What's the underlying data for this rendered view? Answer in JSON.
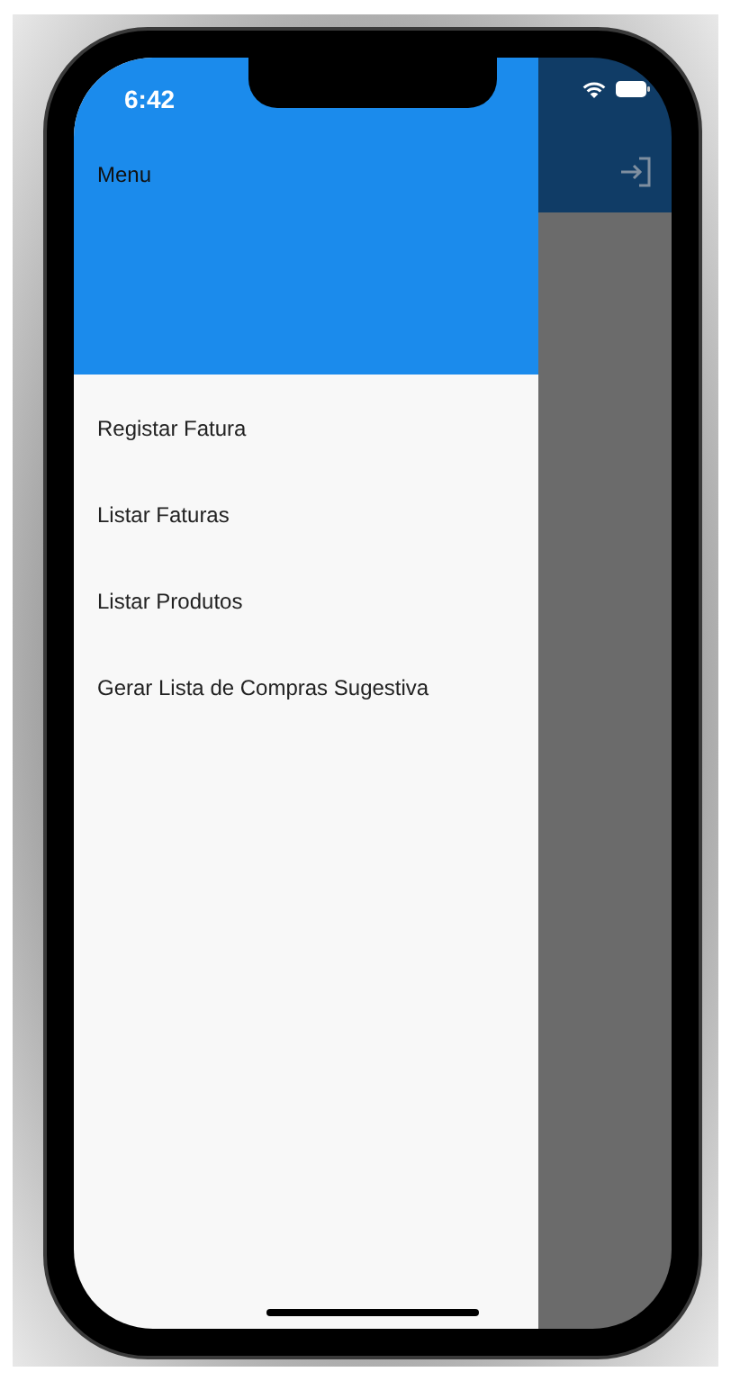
{
  "status_bar": {
    "time": "6:42"
  },
  "drawer": {
    "title": "Menu",
    "items": [
      {
        "label": "Registar Fatura"
      },
      {
        "label": "Listar Faturas"
      },
      {
        "label": "Listar Produtos"
      },
      {
        "label": "Gerar Lista de Compras Sugestiva"
      }
    ]
  }
}
